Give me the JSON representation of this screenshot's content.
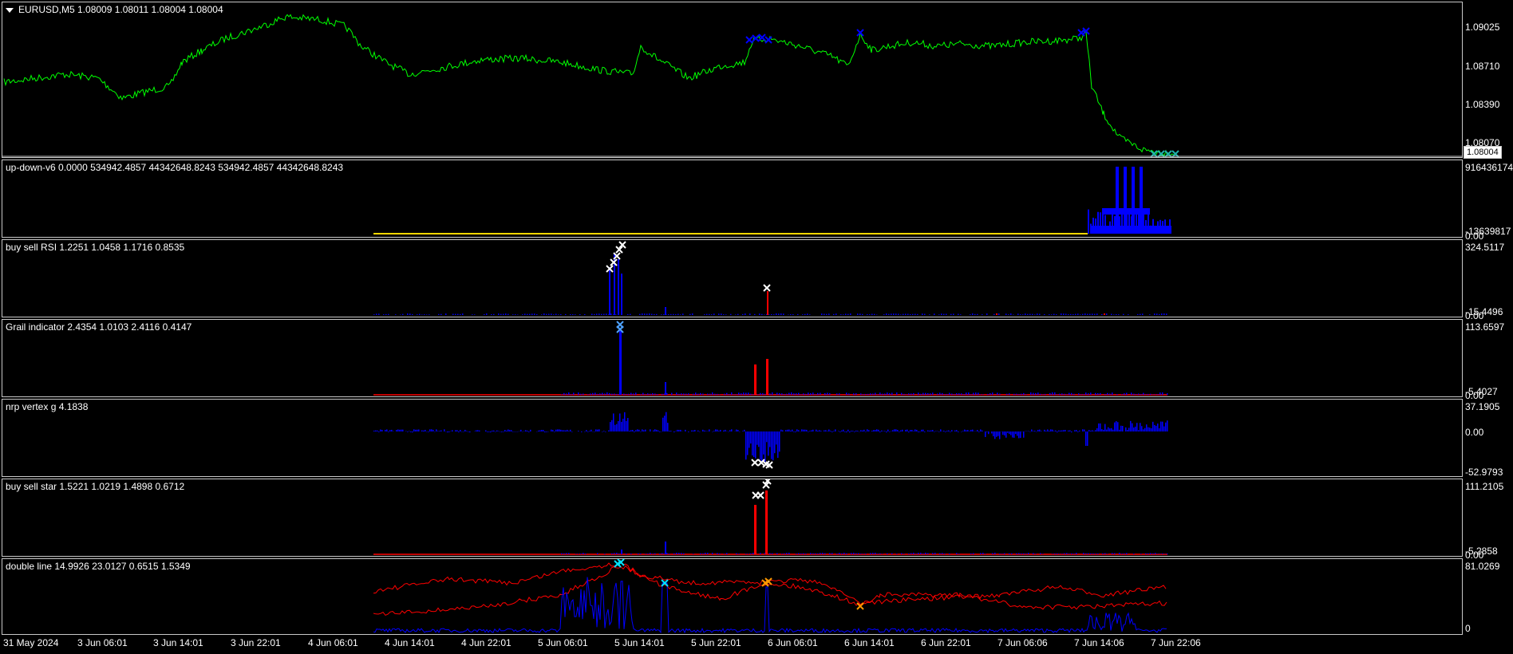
{
  "main": {
    "title": "EURUSD,M5  1.08009 1.08011 1.08004 1.08004",
    "current_price": "1.08004",
    "ticks": [
      "1.09025",
      "1.08710",
      "1.08390",
      "1.08070"
    ],
    "line_color": "#00ff00",
    "marker_color": "#0000ff"
  },
  "panes": [
    {
      "title": "up-down-v6 0.0000 534942.4857 44342648.8243 534942.4857 44342648.8243",
      "ticks": [
        "916436174",
        "-13639817",
        "0.00"
      ],
      "colors": [
        "#ffd700",
        "#0000ff"
      ]
    },
    {
      "title": "buy sell RSI 1.2251 1.0458 1.1716 0.8535",
      "ticks": [
        "324.5117",
        "-15.4496",
        "0.00"
      ],
      "colors": [
        "#0000ff",
        "#ff0000"
      ]
    },
    {
      "title": "Grail indicator 2.4354 1.0103 2.4116 0.4147",
      "ticks": [
        "113.6597",
        "-5.4027",
        "0.00"
      ],
      "colors": [
        "#0000ff",
        "#ff0000"
      ]
    },
    {
      "title": "nrp vertex g 4.1838",
      "ticks": [
        "37.1905",
        "0.00",
        "-52.9793"
      ],
      "colors": [
        "#0000ff"
      ]
    },
    {
      "title": "buy sell star 1.5221 1.0219 1.4898 0.6712",
      "ticks": [
        "111.2105",
        "-5.2858",
        "0.00"
      ],
      "colors": [
        "#ff0000",
        "#0000ff"
      ]
    },
    {
      "title": "double line 14.9926 23.0127 0.6515 1.5349",
      "ticks": [
        "81.0269",
        "0"
      ],
      "colors": [
        "#ff0000",
        "#0000ff"
      ]
    }
  ],
  "time_axis": {
    "labels": [
      "31 May 2024",
      "3 Jun 06:01",
      "3 Jun 14:01",
      "3 Jun 22:01",
      "4 Jun 06:01",
      "4 Jun 14:01",
      "4 Jun 22:01",
      "5 Jun 06:01",
      "5 Jun 14:01",
      "5 Jun 22:01",
      "6 Jun 06:01",
      "6 Jun 14:01",
      "6 Jun 22:01",
      "7 Jun 06:06",
      "7 Jun 14:06",
      "7 Jun 22:06"
    ]
  }
}
